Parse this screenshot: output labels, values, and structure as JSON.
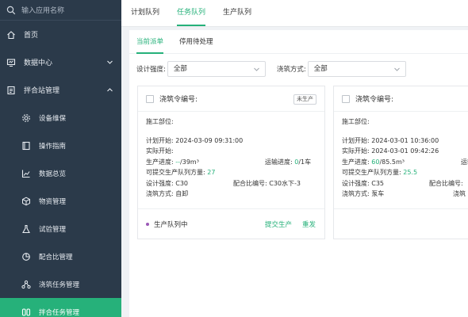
{
  "sidebar": {
    "search_placeholder": "输入应用名称",
    "items": [
      {
        "label": "首页",
        "icon": "home-icon"
      },
      {
        "label": "数据中心",
        "icon": "monitor-icon",
        "chevron": "chevron-down-icon"
      },
      {
        "label": "拌合站管理",
        "icon": "clipboard-icon",
        "chevron": "chevron-up-icon"
      }
    ],
    "subitems": [
      {
        "label": "设备维保",
        "icon": "gear-icon"
      },
      {
        "label": "操作指南",
        "icon": "book-icon"
      },
      {
        "label": "数据总览",
        "icon": "chart-icon"
      },
      {
        "label": "物资管理",
        "icon": "box-icon"
      },
      {
        "label": "试验管理",
        "icon": "flask-icon"
      },
      {
        "label": "配合比管理",
        "icon": "pie-icon"
      },
      {
        "label": "浇筑任务管理",
        "icon": "nodes-icon"
      },
      {
        "label": "拌合任务管理",
        "icon": "mixer-icon",
        "active": true
      }
    ]
  },
  "topbar": {
    "tabs": [
      "计划队列",
      "任务队列",
      "生产队列"
    ],
    "active_tab": "任务队列"
  },
  "subtabs": {
    "tabs": [
      "当前派单",
      "停用待处理"
    ],
    "active_tab": "当前派单"
  },
  "filters": {
    "design_strength_label": "设计强度:",
    "design_strength_value": "全部",
    "pour_method_label": "浇筑方式:",
    "pour_method_value": "全部"
  },
  "cards": [
    {
      "title": "浇筑令编号:",
      "badge": "未生产",
      "site": "施工部位:",
      "plan_start": "计划开始:  2024-03-09 09:31:00",
      "actual_start": "实际开始:",
      "progress_label": "生产进度: ",
      "progress_done": "--",
      "progress_total": "/39m³",
      "transport_label": "运输进度: ",
      "transport_done": "0",
      "transport_total": "/1车",
      "submit_label": "可提交生产队列方量: ",
      "submit_value": "27",
      "design_strength": "设计强度: C30",
      "mix_no": "配合比编号:  C30水下-3",
      "pour_method": "浇筑方式: 自卸",
      "status": "生产队列中",
      "action_submit": "提交生产",
      "action_resend": "重发"
    },
    {
      "title": "浇筑令编号:",
      "site": "施工部位:",
      "plan_start": "计划开始:  2024-03-01 10:36:00",
      "actual_start": "实际开始:  2024-03-01 09:42:26",
      "progress_label": "生产进度: ",
      "progress_done": "60",
      "progress_total": "/85.5m³",
      "transport_label": "运输进度: ",
      "transport_done": "",
      "transport_total": "",
      "submit_label": "可提交生产队列方量: ",
      "submit_value": "25.5",
      "design_strength": "设计强度: C35",
      "mix_no": "配合比编号:",
      "pour_method": "浇筑方式: 泵车",
      "pour_method_right": "浇筑",
      "status": "",
      "action_submit": "",
      "action_resend": ""
    }
  ]
}
